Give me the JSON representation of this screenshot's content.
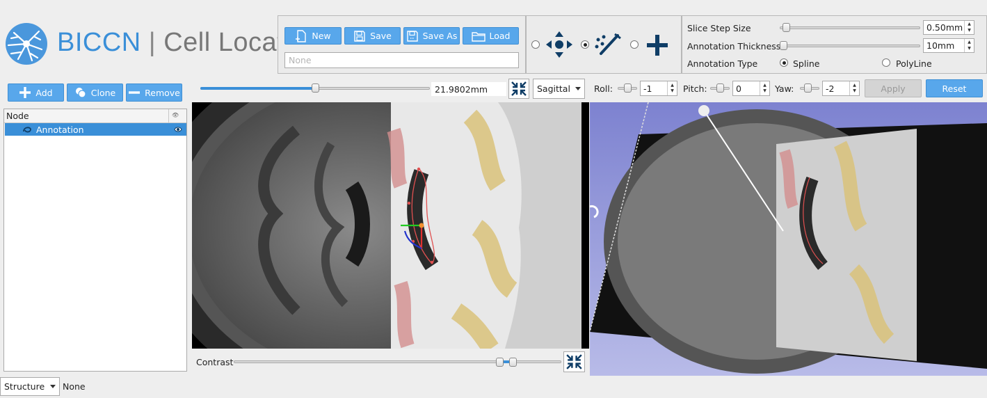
{
  "app": {
    "brand": "BICCN",
    "separator": "|",
    "name": "Cell Locator"
  },
  "file_panel": {
    "new_label": "New",
    "save_label": "Save",
    "save_as_label": "Save As",
    "load_label": "Load",
    "annotation_file_placeholder": "None"
  },
  "settings": {
    "slice_step_label": "Slice Step Size",
    "slice_step_value": "0.50mm",
    "slice_step_level": 0.02,
    "thickness_label": "Annotation Thickness",
    "thickness_value": "10mm",
    "thickness_level": 0.0,
    "annotation_type_label": "Annotation Type",
    "annotation_types": [
      "Spline",
      "PolyLine"
    ],
    "annotation_type_selected": "Spline"
  },
  "node_panel": {
    "add_label": "Add",
    "clone_label": "Clone",
    "remove_label": "Remove",
    "column_header": "Node",
    "nodes": [
      {
        "label": "Annotation",
        "selected": true
      }
    ]
  },
  "slice_toolbar": {
    "offset_value": "21.9802mm",
    "offset_level": 0.5,
    "orientation": "Sagittal",
    "roll_label": "Roll:",
    "roll_value": "-1",
    "pitch_label": "Pitch:",
    "pitch_value": "0",
    "yaw_label": "Yaw:",
    "yaw_value": "-2",
    "apply_label": "Apply",
    "reset_label": "Reset"
  },
  "contrast": {
    "label": "Contrast",
    "range_low": 0.82,
    "range_high": 0.86
  },
  "footer": {
    "structure_label": "Structure",
    "structure_value": "None"
  },
  "colors": {
    "accent": "#3a8fd8",
    "button": "#58a7eb",
    "selection": "#3a8fd8",
    "view3d_background": "#8a8fd6"
  },
  "icons": {
    "logo": "neuron-icon",
    "new": "new-file-icon",
    "save": "floppy-disk-icon",
    "save_as": "floppy-disk-icon",
    "load": "folder-icon",
    "navigate": "pan-arrows-icon",
    "draw": "draw-spline-icon",
    "add_point": "plus-icon"
  }
}
